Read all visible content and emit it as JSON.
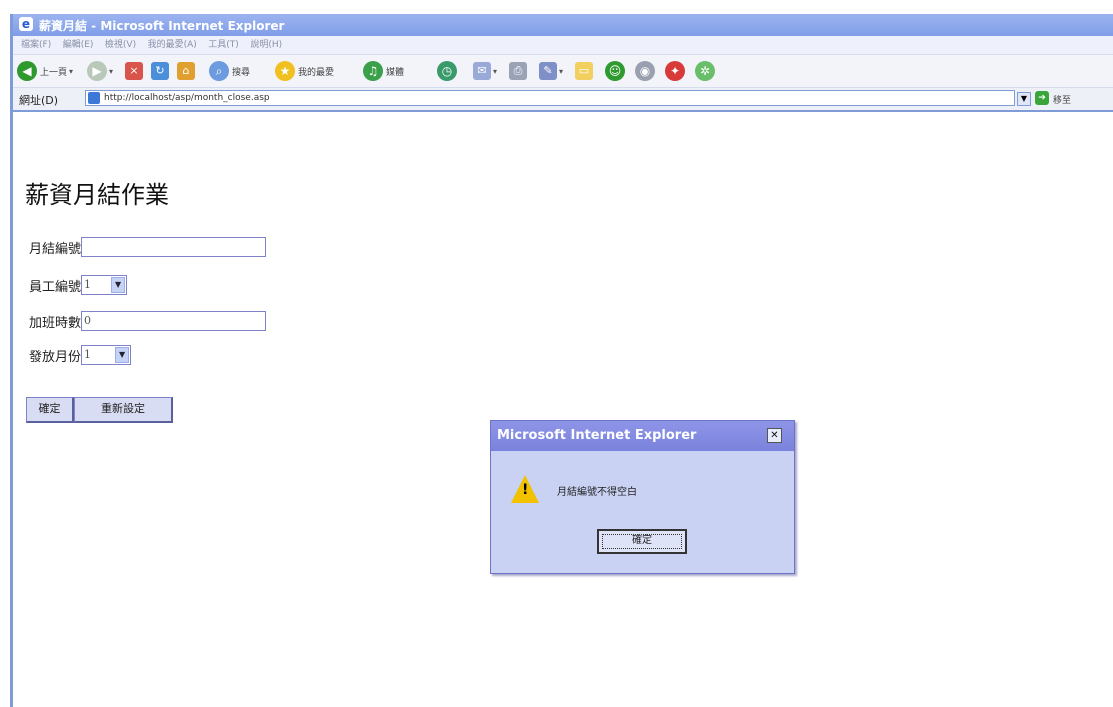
{
  "window": {
    "title": "薪資月結 - Microsoft Internet Explorer"
  },
  "menu": [
    "檔案(F)",
    "編輯(E)",
    "檢視(V)",
    "我的最愛(A)",
    "工具(T)",
    "說明(H)"
  ],
  "toolbar": {
    "back_label": "上一頁",
    "search_label": "搜尋",
    "favorites_label": "我的最愛",
    "media_label": "媒體",
    "icons": [
      "back-icon",
      "forward-icon",
      "stop-icon",
      "refresh-icon",
      "home-icon",
      "search-icon",
      "favorites-icon",
      "media-icon",
      "history-icon",
      "mail-icon",
      "print-icon",
      "edit-icon",
      "folder-icon",
      "messenger-icon",
      "discuss-icon",
      "research-icon",
      "tools-icon"
    ]
  },
  "address": {
    "label": "網址(D)",
    "url": "http://localhost/asp/month_close.asp",
    "go_label": "移至"
  },
  "page": {
    "title": "薪資月結作業",
    "fields": {
      "close_no": {
        "label": "月結編號",
        "value": ""
      },
      "emp_no": {
        "label": "員工編號",
        "value": "1"
      },
      "overtime": {
        "label": "加班時數",
        "value": "0"
      },
      "pay_month": {
        "label": "發放月份",
        "value": "1"
      }
    },
    "buttons": {
      "submit": "確定",
      "reset": "重新設定"
    }
  },
  "dialog": {
    "title": "Microsoft Internet Explorer",
    "message": "月結編號不得空白",
    "ok_label": "確定",
    "icon": "warning-icon"
  },
  "colors": {
    "title_bar": "#8ea5ee",
    "dialog_bg": "#c9d2f3",
    "dialog_title": "#7f87e0"
  }
}
